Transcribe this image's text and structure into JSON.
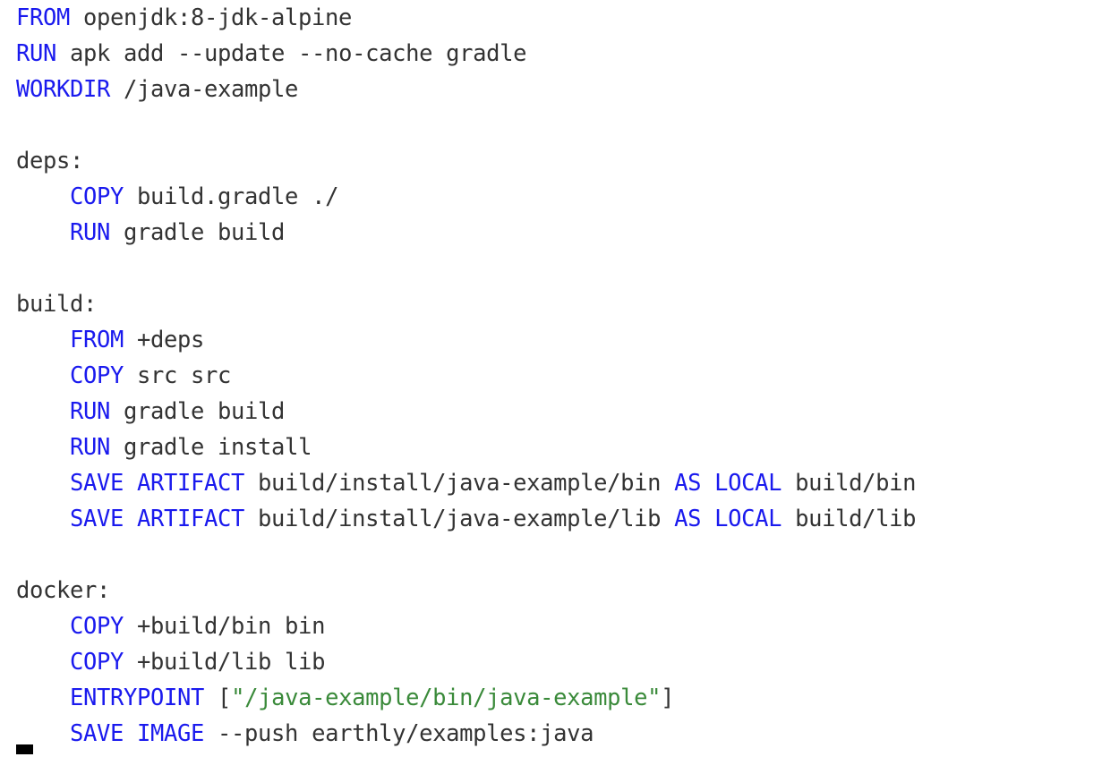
{
  "viewer": {
    "name": "earthfile-code-view",
    "background_color": "#ffffff",
    "text_color": "#333333",
    "keyword_color": "#1a1aee",
    "string_color": "#3a8a3a",
    "cursor_color": "#000000"
  },
  "code": {
    "language": "Earthfile",
    "lines": [
      {
        "index": 0,
        "text": "FROM openjdk:8-jdk-alpine",
        "tokens": [
          {
            "t": "FROM",
            "k": "kw"
          },
          {
            "t": " openjdk:8-jdk-alpine",
            "k": "text"
          }
        ]
      },
      {
        "index": 1,
        "text": "RUN apk add --update --no-cache gradle",
        "tokens": [
          {
            "t": "RUN",
            "k": "kw"
          },
          {
            "t": " apk add --update --no-cache gradle",
            "k": "text"
          }
        ]
      },
      {
        "index": 2,
        "text": "WORKDIR /java-example",
        "tokens": [
          {
            "t": "WORKDIR",
            "k": "kw"
          },
          {
            "t": " /java-example",
            "k": "text"
          }
        ]
      },
      {
        "index": 3,
        "text": "",
        "tokens": []
      },
      {
        "index": 4,
        "text": "deps:",
        "tokens": [
          {
            "t": "deps:",
            "k": "text"
          }
        ]
      },
      {
        "index": 5,
        "text": "    COPY build.gradle ./",
        "tokens": [
          {
            "t": "    ",
            "k": "text"
          },
          {
            "t": "COPY",
            "k": "kw"
          },
          {
            "t": " build.gradle ./",
            "k": "text"
          }
        ]
      },
      {
        "index": 6,
        "text": "    RUN gradle build",
        "tokens": [
          {
            "t": "    ",
            "k": "text"
          },
          {
            "t": "RUN",
            "k": "kw"
          },
          {
            "t": " gradle build",
            "k": "text"
          }
        ]
      },
      {
        "index": 7,
        "text": "",
        "tokens": []
      },
      {
        "index": 8,
        "text": "build:",
        "tokens": [
          {
            "t": "build:",
            "k": "text"
          }
        ]
      },
      {
        "index": 9,
        "text": "    FROM +deps",
        "tokens": [
          {
            "t": "    ",
            "k": "text"
          },
          {
            "t": "FROM",
            "k": "kw"
          },
          {
            "t": " +deps",
            "k": "text"
          }
        ]
      },
      {
        "index": 10,
        "text": "    COPY src src",
        "tokens": [
          {
            "t": "    ",
            "k": "text"
          },
          {
            "t": "COPY",
            "k": "kw"
          },
          {
            "t": " src src",
            "k": "text"
          }
        ]
      },
      {
        "index": 11,
        "text": "    RUN gradle build",
        "tokens": [
          {
            "t": "    ",
            "k": "text"
          },
          {
            "t": "RUN",
            "k": "kw"
          },
          {
            "t": " gradle build",
            "k": "text"
          }
        ]
      },
      {
        "index": 12,
        "text": "    RUN gradle install",
        "tokens": [
          {
            "t": "    ",
            "k": "text"
          },
          {
            "t": "RUN",
            "k": "kw"
          },
          {
            "t": " gradle install",
            "k": "text"
          }
        ]
      },
      {
        "index": 13,
        "text": "    SAVE ARTIFACT build/install/java-example/bin AS LOCAL build/bin",
        "tokens": [
          {
            "t": "    ",
            "k": "text"
          },
          {
            "t": "SAVE ARTIFACT",
            "k": "kw"
          },
          {
            "t": " build/install/java-example/bin ",
            "k": "text"
          },
          {
            "t": "AS LOCAL",
            "k": "kw"
          },
          {
            "t": " build/bin",
            "k": "text"
          }
        ]
      },
      {
        "index": 14,
        "text": "    SAVE ARTIFACT build/install/java-example/lib AS LOCAL build/lib",
        "tokens": [
          {
            "t": "    ",
            "k": "text"
          },
          {
            "t": "SAVE ARTIFACT",
            "k": "kw"
          },
          {
            "t": " build/install/java-example/lib ",
            "k": "text"
          },
          {
            "t": "AS LOCAL",
            "k": "kw"
          },
          {
            "t": " build/lib",
            "k": "text"
          }
        ]
      },
      {
        "index": 15,
        "text": "",
        "tokens": []
      },
      {
        "index": 16,
        "text": "docker:",
        "tokens": [
          {
            "t": "docker:",
            "k": "text"
          }
        ]
      },
      {
        "index": 17,
        "text": "    COPY +build/bin bin",
        "tokens": [
          {
            "t": "    ",
            "k": "text"
          },
          {
            "t": "COPY",
            "k": "kw"
          },
          {
            "t": " +build/bin bin",
            "k": "text"
          }
        ]
      },
      {
        "index": 18,
        "text": "    COPY +build/lib lib",
        "tokens": [
          {
            "t": "    ",
            "k": "text"
          },
          {
            "t": "COPY",
            "k": "kw"
          },
          {
            "t": " +build/lib lib",
            "k": "text"
          }
        ]
      },
      {
        "index": 19,
        "text": "    ENTRYPOINT [\"/java-example/bin/java-example\"]",
        "tokens": [
          {
            "t": "    ",
            "k": "text"
          },
          {
            "t": "ENTRYPOINT",
            "k": "kw"
          },
          {
            "t": " [",
            "k": "punct"
          },
          {
            "t": "\"/java-example/bin/java-example\"",
            "k": "str"
          },
          {
            "t": "]",
            "k": "punct"
          }
        ]
      },
      {
        "index": 20,
        "text": "    SAVE IMAGE --push earthly/examples:java",
        "tokens": [
          {
            "t": "    ",
            "k": "text"
          },
          {
            "t": "SAVE IMAGE",
            "k": "kw"
          },
          {
            "t": " --push earthly/examples:java",
            "k": "text"
          }
        ]
      }
    ]
  },
  "cursor": {
    "name": "text-cursor",
    "visible": true,
    "line_index": 21,
    "column": 0
  }
}
